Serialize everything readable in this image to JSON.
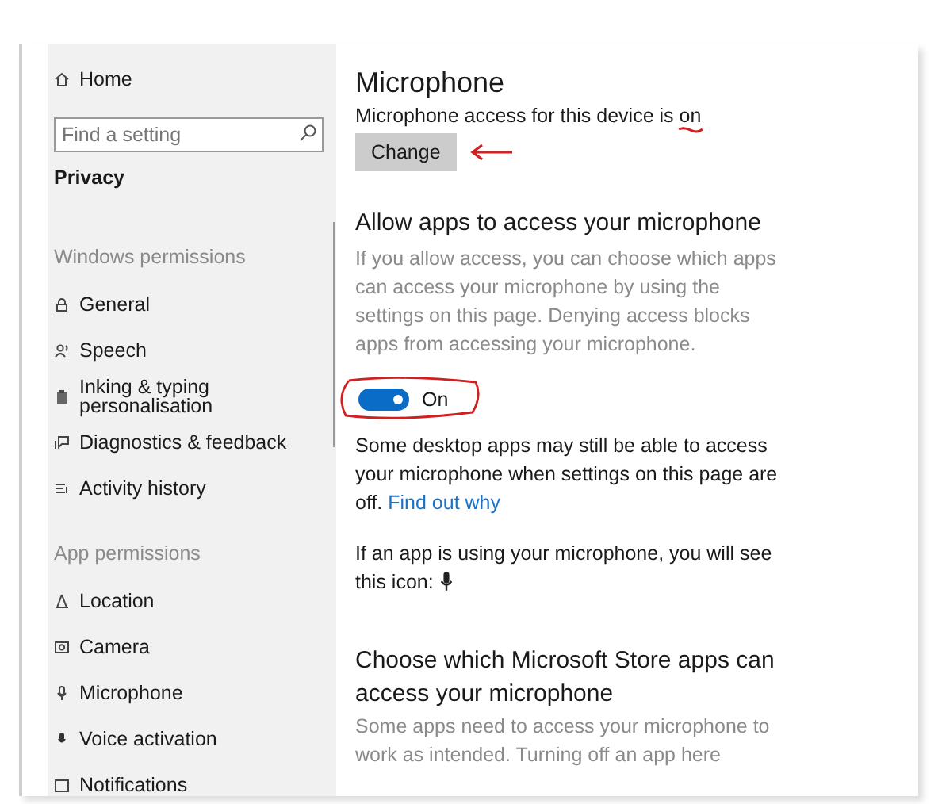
{
  "sidebar": {
    "home": {
      "label": "Home"
    },
    "search": {
      "placeholder": "Find a setting"
    },
    "section_title": "Privacy",
    "groups": [
      {
        "heading": "Windows permissions",
        "items": [
          {
            "label": "General"
          },
          {
            "label": "Speech"
          },
          {
            "label": "Inking & typing personalisation"
          },
          {
            "label": "Diagnostics & feedback"
          },
          {
            "label": "Activity history"
          }
        ]
      },
      {
        "heading": "App permissions",
        "items": [
          {
            "label": "Location"
          },
          {
            "label": "Camera"
          },
          {
            "label": "Microphone"
          },
          {
            "label": "Voice activation"
          },
          {
            "label": "Notifications"
          }
        ]
      }
    ]
  },
  "content": {
    "title": "Microphone",
    "access_text": "Microphone access for this device is on",
    "change_button": "Change",
    "allow_heading": "Allow apps to access your microphone",
    "allow_description": "If you allow access, you can choose which apps can access your microphone by using the settings on this page. Denying access blocks apps from accessing your microphone.",
    "toggle": {
      "on": true,
      "label": "On"
    },
    "desktop_note": "Some desktop apps may still be able to access your microphone when settings on this page are off.",
    "link": "Find out why",
    "icon_note": "If an app is using your microphone, you will see this icon:",
    "store_heading": "Choose which Microsoft Store apps can access your microphone",
    "store_description": "Some apps need to access your microphone to work as intended. Turning off an app here"
  }
}
